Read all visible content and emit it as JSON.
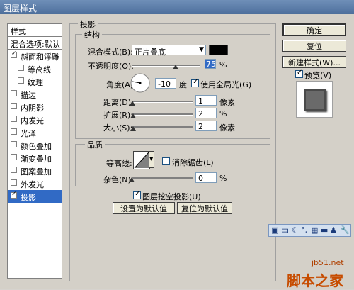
{
  "window": {
    "title": "图层样式"
  },
  "sidebar": {
    "items": [
      {
        "label": "样式",
        "checkbox": false,
        "checked": false,
        "indent": 0
      },
      {
        "label": "混合选项:默认",
        "checkbox": false,
        "checked": false,
        "indent": 0
      },
      {
        "label": "斜面和浮雕",
        "checkbox": true,
        "checked": true,
        "indent": 0
      },
      {
        "label": "等高线",
        "checkbox": true,
        "checked": false,
        "indent": 1
      },
      {
        "label": "纹理",
        "checkbox": true,
        "checked": false,
        "indent": 1
      },
      {
        "label": "描边",
        "checkbox": true,
        "checked": false,
        "indent": 0
      },
      {
        "label": "内阴影",
        "checkbox": true,
        "checked": false,
        "indent": 0
      },
      {
        "label": "内发光",
        "checkbox": true,
        "checked": false,
        "indent": 0
      },
      {
        "label": "光泽",
        "checkbox": true,
        "checked": false,
        "indent": 0
      },
      {
        "label": "颜色叠加",
        "checkbox": true,
        "checked": false,
        "indent": 0
      },
      {
        "label": "渐变叠加",
        "checkbox": true,
        "checked": false,
        "indent": 0
      },
      {
        "label": "图案叠加",
        "checkbox": true,
        "checked": false,
        "indent": 0
      },
      {
        "label": "外发光",
        "checkbox": true,
        "checked": false,
        "indent": 0
      },
      {
        "label": "投影",
        "checkbox": true,
        "checked": true,
        "indent": 0,
        "selected": true
      }
    ]
  },
  "shadow": {
    "section_title": "投影",
    "structure": {
      "title": "结构",
      "blend_mode_label": "混合模式(B):",
      "blend_mode_value": "正片叠底",
      "blend_color": "#000000",
      "opacity_label": "不透明度(O):",
      "opacity_value": "75",
      "opacity_unit": "%",
      "angle_label": "角度(A):",
      "angle_value": "-10",
      "angle_unit": "度",
      "global_light_label": "使用全局光(G)",
      "global_light_checked": true,
      "distance_label": "距离(D):",
      "distance_value": "1",
      "distance_unit": "像素",
      "spread_label": "扩展(R):",
      "spread_value": "2",
      "spread_unit": "%",
      "size_label": "大小(S):",
      "size_value": "2",
      "size_unit": "像素"
    },
    "quality": {
      "title": "品质",
      "contour_label": "等高线:",
      "antialias_label": "消除锯齿(L)",
      "antialias_checked": false,
      "noise_label": "杂色(N):",
      "noise_value": "0",
      "noise_unit": "%"
    },
    "knockout_label": "图层挖空投影(U)",
    "knockout_checked": true,
    "make_default_label": "设置为默认值",
    "reset_default_label": "复位为默认值"
  },
  "buttons": {
    "ok": "确定",
    "reset": "复位",
    "new_style": "新建样式(W)...",
    "preview_label": "预览(V)",
    "preview_checked": true
  },
  "ime": {
    "mode": "中"
  },
  "watermark": {
    "site": "jb51.net",
    "brand": "脚本之家"
  }
}
